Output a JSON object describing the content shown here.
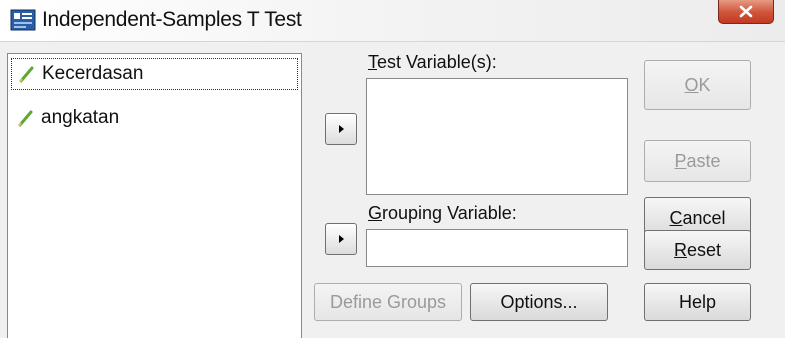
{
  "window": {
    "title": "Independent-Samples T Test",
    "close_label": "X"
  },
  "source_list": {
    "items": [
      {
        "label": "Kecerdasan",
        "focused": true
      },
      {
        "label": "angkatan",
        "focused": false
      }
    ]
  },
  "test_variables": {
    "label_mnemonic": "T",
    "label_rest": "est Variable(s):"
  },
  "grouping_variable": {
    "label_mnemonic": "G",
    "label_rest": "rouping Variable:",
    "value": ""
  },
  "buttons": {
    "ok": {
      "mnemonic": "O",
      "rest": "K"
    },
    "paste": {
      "mnemonic": "P",
      "rest": "aste"
    },
    "cancel": {
      "mnemonic": "C",
      "rest": "ancel"
    },
    "reset": {
      "mnemonic": "R",
      "rest": "eset"
    },
    "help": "Help",
    "define_groups": "Define Groups",
    "options": "Options..."
  },
  "colors": {
    "variable_pencil": "#5fa832",
    "close_button": "#c8452c",
    "disabled_text": "#9a9a9a"
  },
  "icons": {
    "app": "spss-dialog-icon",
    "variable": "scale-pencil-icon",
    "move": "right-arrow-icon"
  }
}
